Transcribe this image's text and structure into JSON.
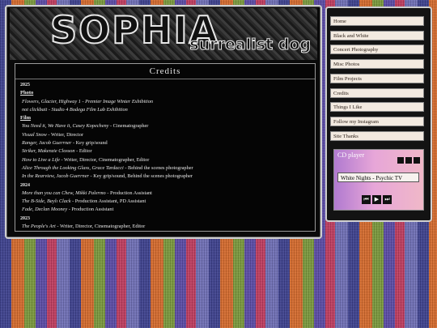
{
  "banner": {
    "title": "SOPHIA",
    "subtitle": "surrealist dog"
  },
  "credits": {
    "header": "Credits",
    "entries": [
      {
        "type": "year",
        "text": "2025"
      },
      {
        "type": "section",
        "text": "Photo"
      },
      {
        "type": "item",
        "title": "Flowers, Glacier, Highway 1 - Premier Image Winter Exhibition",
        "role": ""
      },
      {
        "type": "item",
        "title": "not clickbait - Studio 4 Bodega Film Lab Exhibition",
        "role": ""
      },
      {
        "type": "section",
        "text": "Film"
      },
      {
        "type": "item",
        "title": "You Need it, We Have it, Casey Kopecheny",
        "role": " - Cinematographer"
      },
      {
        "type": "item",
        "title": "Visual Snow",
        "role": " - Writer, Director"
      },
      {
        "type": "item",
        "title": "Ranger, Jacob Guerrner",
        "role": " - Key grip/sound"
      },
      {
        "type": "item",
        "title": "Striker, Makenzie Closson",
        "role": " - Editor"
      },
      {
        "type": "item",
        "title": "How to Live a Life",
        "role": " - Writer, Director, Cinematographer, Editor"
      },
      {
        "type": "item",
        "title": "Alice Through the Looking Glass, Grace Tardacci",
        "role": " - Behind the scenes photographer"
      },
      {
        "type": "item",
        "title": "In the Rearview, Jacob Guerrner",
        "role": " - Key grip/sound, Behind the scenes photographer"
      },
      {
        "type": "year",
        "text": "2024"
      },
      {
        "type": "item",
        "title": "More than you can Chew, Mikki Palermo",
        "role": " - Production Assistant"
      },
      {
        "type": "item",
        "title": "The B-Side, Baylı Clack",
        "role": " - Production Assistant, PD Assistant"
      },
      {
        "type": "item",
        "title": "Fade, Declan Mooney",
        "role": " - Production Assistant"
      },
      {
        "type": "year",
        "text": "2023"
      },
      {
        "type": "item",
        "title": "The People's Art",
        "role": " - Writer, Director, Cinematographer, Editor"
      }
    ]
  },
  "nav": {
    "items": [
      "Home",
      "Black and White",
      "Concert Photography",
      "Misc Photos",
      "Film Projects",
      "Credits",
      "Things I Like",
      "Follow my Instagram",
      "Site Thanks"
    ]
  },
  "cd_player": {
    "title": "CD player",
    "track": "White Nights - Psychic TV",
    "prev_icon": "previous-icon",
    "play_icon": "play-icon",
    "next_icon": "next-icon"
  }
}
